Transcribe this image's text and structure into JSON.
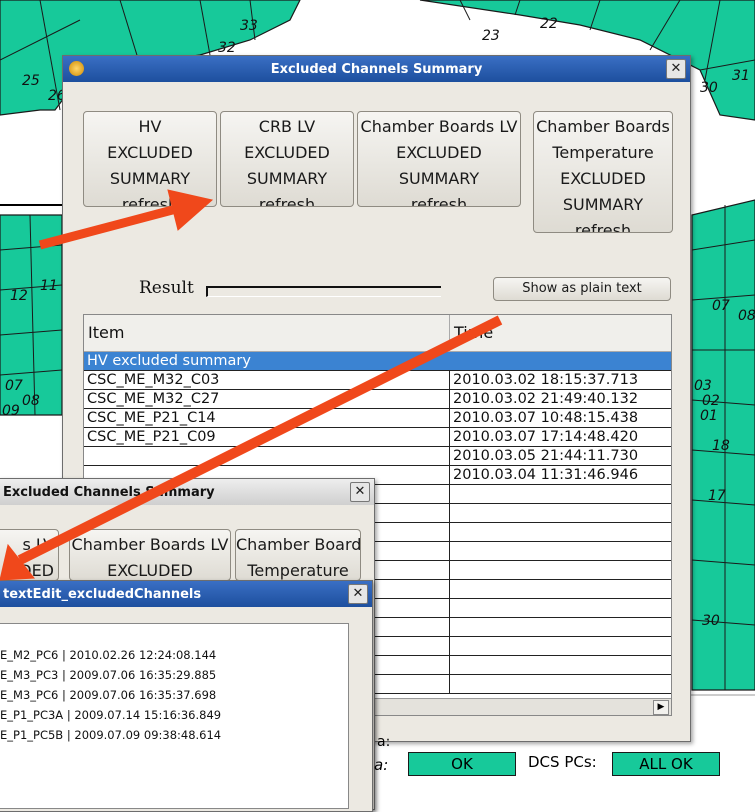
{
  "main_window": {
    "title": "Excluded Channels Summary",
    "buttons": [
      {
        "lines": [
          "HV",
          "EXCLUDED",
          "SUMMARY",
          "refresh"
        ]
      },
      {
        "lines": [
          "CRB LV",
          "EXCLUDED",
          "SUMMARY",
          "refresh"
        ]
      },
      {
        "lines": [
          "Chamber Boards LV",
          "EXCLUDED",
          "SUMMARY",
          "refresh"
        ]
      },
      {
        "lines": [
          "Chamber Boards",
          "Temperature",
          "EXCLUDED",
          "SUMMARY",
          "refresh"
        ]
      }
    ],
    "result_label": "Result",
    "plain_text_button": "Show as plain text",
    "table": {
      "columns": [
        "Item",
        "Time"
      ],
      "rows": [
        {
          "item": "HV excluded summary",
          "time": ""
        },
        {
          "item": "CSC_ME_M32_C03",
          "time": "2010.03.02 18:15:37.713"
        },
        {
          "item": "CSC_ME_M32_C27",
          "time": "2010.03.02 21:49:40.132"
        },
        {
          "item": "CSC_ME_P21_C14",
          "time": "2010.03.07 10:48:15.438"
        },
        {
          "item": "CSC_ME_P21_C09",
          "time": "2010.03.07 17:14:48.420"
        },
        {
          "item": "",
          "time": "2010.03.05 21:44:11.730"
        },
        {
          "item": "",
          "time": "2010.03.04 11:31:46.946"
        }
      ]
    }
  },
  "second_window": {
    "title": "Excluded Channels Summary",
    "buttons": [
      {
        "lines": [
          "s LV",
          "UDED"
        ]
      },
      {
        "lines": [
          "Chamber Boards LV",
          "EXCLUDED"
        ]
      },
      {
        "lines": [
          "Chamber Boards",
          "Temperature"
        ]
      }
    ]
  },
  "text_dialog": {
    "title": "textEdit_excludedChannels",
    "lines": [
      "E_M2_PC6 | 2010.02.26 12:24:08.144",
      "E_M3_PC3 | 2009.07.06 16:35:29.885",
      "E_M3_PC6 | 2009.07.06 16:35:37.698",
      "E_P1_PC3A | 2009.07.14 15:16:36.849",
      "E_P1_PC5B | 2009.07.09 09:38:48.614"
    ]
  },
  "status": {
    "left_label": "a:",
    "left_value": "OK",
    "dcs_label": "DCS PCs:",
    "dcs_value": "ALL OK"
  },
  "background_labels": [
    "33",
    "32",
    "25",
    "26",
    "22",
    "23",
    "30",
    "31",
    "12",
    "11",
    "07",
    "08",
    "09",
    "07",
    "08",
    "03",
    "02",
    "01",
    "18",
    "17",
    "30"
  ],
  "colors": {
    "sector": "#17c99a",
    "titlebar": "#1d4f9e",
    "selection": "#3b83d2",
    "arrow": "#f0481b"
  }
}
